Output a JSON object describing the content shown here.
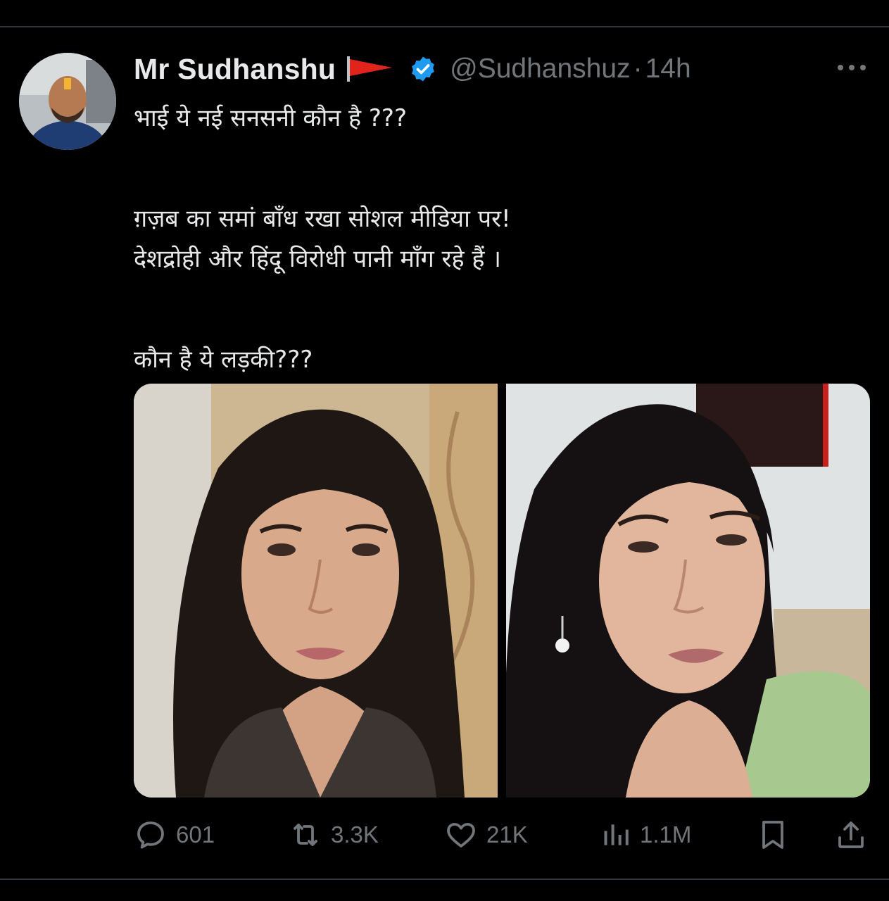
{
  "tweet": {
    "author": {
      "display_name": "Mr Sudhanshu",
      "handle": "@Sudhanshuz",
      "separator": "·",
      "time": "14h",
      "verified_color": "#1d9bf0",
      "flag_color": "#e0241b"
    },
    "text_lines": [
      "भाई ये नई सनसनी कौन है ???",
      "",
      "ग़ज़ब का समां बाँध रखा सोशल मीडिया पर!",
      "देशद्रोही और हिंदू विरोधी पानी माँग रहे हैं ।",
      "",
      "कौन है ये लड़की???"
    ],
    "media": [
      {
        "icon": "photo-left"
      },
      {
        "icon": "photo-right"
      }
    ],
    "actions": {
      "replies": "601",
      "retweets": "3.3K",
      "likes": "21K",
      "views": "1.1M"
    }
  },
  "icons": {
    "more": "more-dots-icon",
    "reply": "reply-bubble-icon",
    "retweet": "retweet-icon",
    "like": "heart-icon",
    "views": "bar-chart-icon",
    "bookmark": "bookmark-icon",
    "share": "share-icon"
  },
  "colors": {
    "background": "#000000",
    "text_primary": "#e7e9ea",
    "text_secondary": "#71767b",
    "divider": "#2f3336"
  }
}
